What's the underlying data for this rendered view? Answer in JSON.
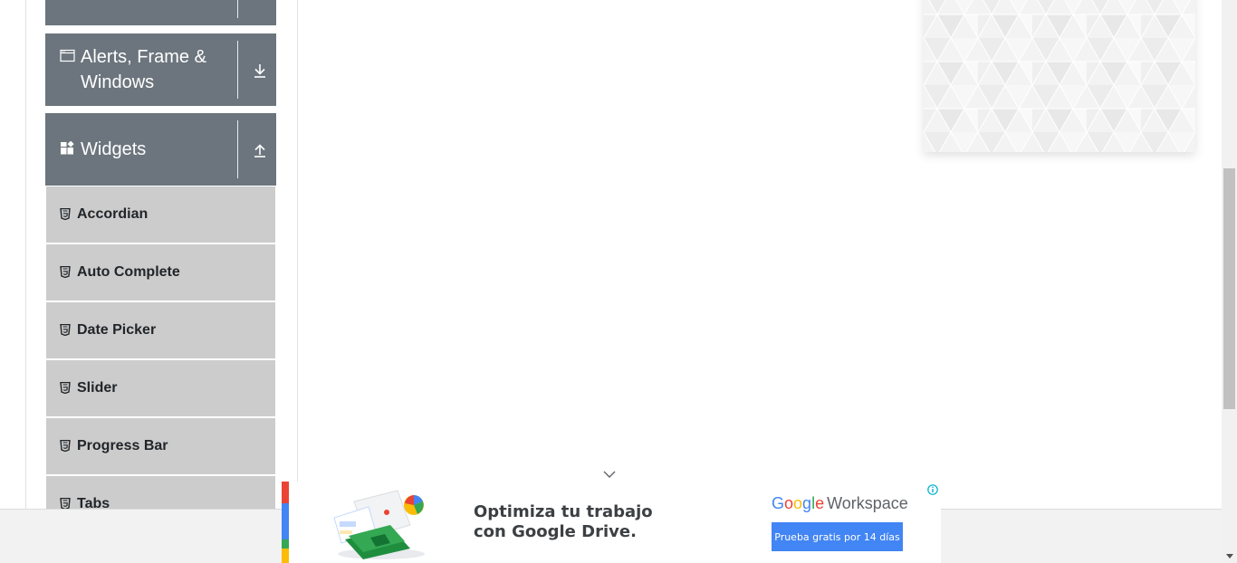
{
  "sidebar": {
    "groups": [
      {
        "label": "Alerts, Frame & Windows",
        "label_line1": "Alerts, Frame &",
        "label_line2": "Windows",
        "toggle": "download-arrow"
      },
      {
        "label": "Widgets",
        "toggle": "upload-arrow"
      }
    ],
    "items": [
      {
        "label": "Accordian"
      },
      {
        "label": "Auto Complete"
      },
      {
        "label": "Date Picker"
      },
      {
        "label": "Slider"
      },
      {
        "label": "Progress Bar"
      },
      {
        "label": "Tabs"
      }
    ]
  },
  "ad": {
    "headline_line1": "Optimiza tu trabajo",
    "headline_line2": "con Google Drive.",
    "brand_g1": "G",
    "brand_g2": "o",
    "brand_g3": "o",
    "brand_g4": "g",
    "brand_g5": "l",
    "brand_g6": "e",
    "brand_product": "Workspace",
    "cta_label": "Prueba gratis por 14 días"
  },
  "colors": {
    "group_header_bg": "#6c757d",
    "menu_item_bg": "#cccccc",
    "cta_blue": "#4285f4"
  }
}
